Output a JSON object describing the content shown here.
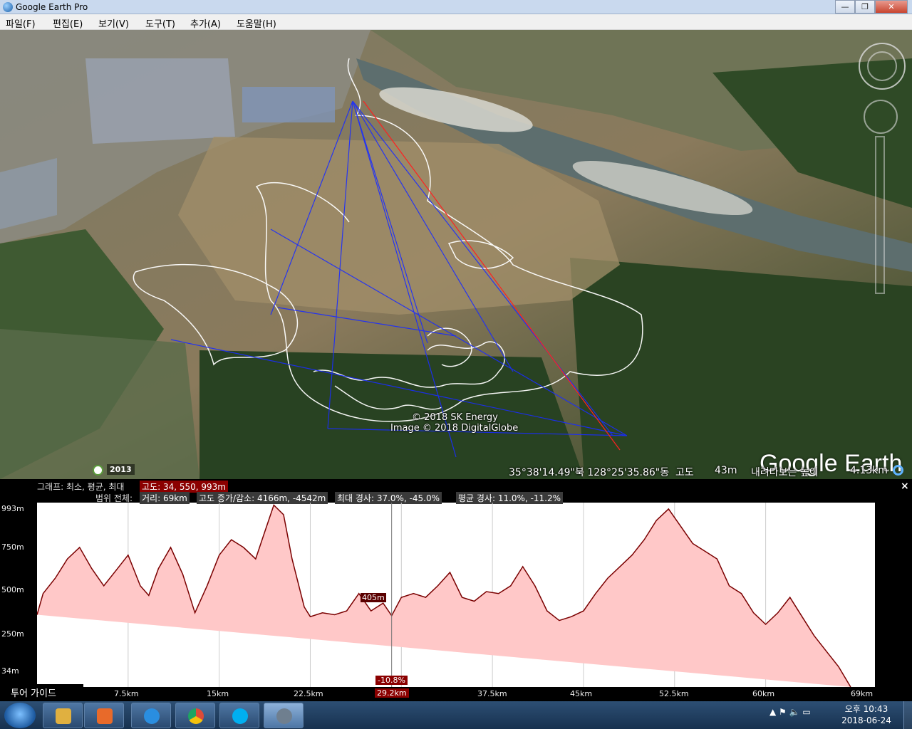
{
  "window": {
    "title": "Google Earth Pro",
    "minimize": "—",
    "maximize": "❐",
    "close": "✕"
  },
  "menu": [
    {
      "label": "파일(F)"
    },
    {
      "label": "편집(E)"
    },
    {
      "label": "보기(V)"
    },
    {
      "label": "도구(T)"
    },
    {
      "label": "추가(A)"
    },
    {
      "label": "도움말(H)"
    }
  ],
  "map": {
    "logo": "Google Earth",
    "copyright1": "© 2018 SK Energy",
    "copyright2": "Image © 2018 DigitalGlobe",
    "year": "2013",
    "coords": "35°38'14.49\"북  128°25'35.86\"동",
    "altitude_label": "고도",
    "altitude_value": "43m",
    "eye_label": "내려다보는 높이",
    "eye_value": "4.13km"
  },
  "profile": {
    "graph_label": "그래프: 최소, 평균, 최대",
    "graph_value": "고도: 34, 550, 993m",
    "range_label": "범위 전체:",
    "distance": "거리: 69km",
    "gain_loss": "고도 증가/감소: 4166m, -4542m",
    "max_slope": "최대 경사: 37.0%, -45.0%",
    "avg_slope": "평균 경사: 11.0%, -11.2%",
    "close": "×",
    "cursor_value": "405m",
    "cursor_slope": "-10.8%",
    "cursor_distance": "29.2km",
    "y_ticks": [
      "993m",
      "750m",
      "500m",
      "250m",
      "34m"
    ],
    "x_ticks": [
      "7.5km",
      "15km",
      "22.5km",
      "37.5km",
      "45km",
      "52.5km",
      "60km",
      "69km"
    ]
  },
  "tour_guide": "투어 가이드",
  "taskbar": {
    "apps": [
      {
        "name": "file-explorer",
        "color": "#e0b040"
      },
      {
        "name": "media-player",
        "color": "#e86a2a"
      },
      {
        "name": "internet-explorer",
        "color": "#2a8ee0"
      },
      {
        "name": "chrome",
        "color": "#dd4b39"
      },
      {
        "name": "skype",
        "color": "#00aff0"
      },
      {
        "name": "google-earth-pro",
        "color": "#6f7f8f"
      }
    ],
    "tray": "▲  ⚑  🔈  ▭",
    "time": "오후 10:43",
    "date": "2018-06-24"
  },
  "chart_data": {
    "type": "area",
    "title": "",
    "xlabel": "",
    "ylabel": "",
    "xlim": [
      0,
      69
    ],
    "ylim": [
      34,
      993
    ],
    "x": [
      0,
      0.5,
      1.5,
      2.5,
      3.5,
      4.5,
      5.5,
      6.5,
      7.5,
      8.5,
      9.2,
      10,
      11,
      12,
      13,
      14,
      15,
      16,
      17,
      18,
      18.8,
      19.5,
      20.3,
      21,
      22,
      22.5,
      23.5,
      24.5,
      25.5,
      26.5,
      27.5,
      28.5,
      29.2,
      30,
      31,
      32,
      33,
      34,
      35,
      36,
      37,
      38,
      39,
      40,
      41,
      42,
      43,
      44,
      45,
      46,
      47,
      48,
      49,
      50,
      51,
      52,
      53,
      54,
      55,
      56,
      57,
      58,
      59,
      60,
      61,
      62,
      63,
      64,
      65,
      66,
      67,
      68,
      69
    ],
    "y": [
      410,
      520,
      600,
      700,
      760,
      650,
      560,
      640,
      720,
      560,
      510,
      650,
      760,
      620,
      420,
      560,
      720,
      800,
      760,
      700,
      850,
      980,
      930,
      700,
      450,
      400,
      420,
      410,
      430,
      520,
      430,
      470,
      405,
      500,
      520,
      500,
      560,
      630,
      500,
      480,
      530,
      520,
      560,
      660,
      560,
      430,
      380,
      400,
      430,
      520,
      600,
      660,
      720,
      800,
      900,
      960,
      870,
      780,
      740,
      700,
      560,
      520,
      420,
      360,
      420,
      500,
      400,
      300,
      220,
      140,
      34
    ],
    "series_color": "#7a0000",
    "fill_color": "#ffc8c8",
    "grid": true
  }
}
